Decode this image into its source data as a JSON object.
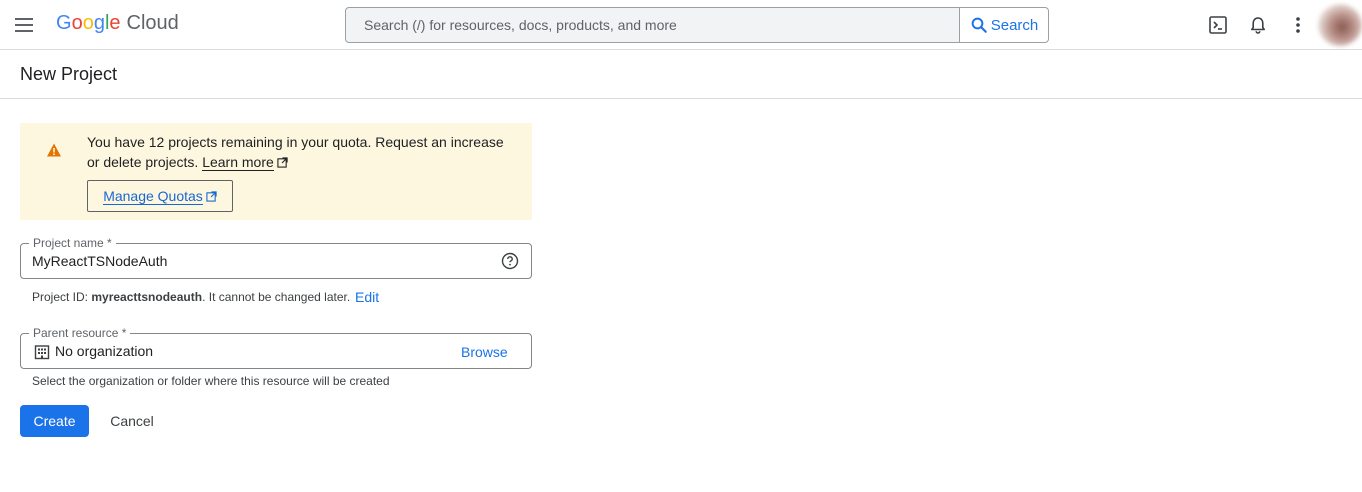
{
  "header": {
    "menu_icon": "hamburger-menu-icon",
    "logo": {
      "google_letters": [
        "G",
        "o",
        "o",
        "g",
        "l",
        "e"
      ],
      "product": "Cloud"
    },
    "search": {
      "placeholder": "Search (/) for resources, docs, products, and more",
      "button_label": "Search"
    },
    "actions": [
      "cloud-shell-icon",
      "notifications-bell-icon",
      "more-vert-icon",
      "avatar"
    ]
  },
  "page": {
    "title": "New Project"
  },
  "quota_notice": {
    "text": "You have 12 projects remaining in your quota. Request an increase or delete projects.",
    "learn_more": "Learn more",
    "manage_quotas": "Manage Quotas"
  },
  "project_name": {
    "label": "Project name *",
    "value": "MyReactTSNodeAuth",
    "hint_prefix": "Project ID: ",
    "project_id": "myreacttsnodeauth",
    "hint_suffix": ". It cannot be changed later.",
    "edit_label": "Edit"
  },
  "parent_resource": {
    "label": "Parent resource *",
    "value": "No organization",
    "browse_label": "Browse",
    "hint": "Select the organization or folder where this resource will be created"
  },
  "actions": {
    "create": "Create",
    "cancel": "Cancel"
  },
  "colors": {
    "primary": "#1a73e8",
    "warning_bg": "#fef7e0",
    "warning_icon": "#e37400",
    "text": "#202124"
  }
}
